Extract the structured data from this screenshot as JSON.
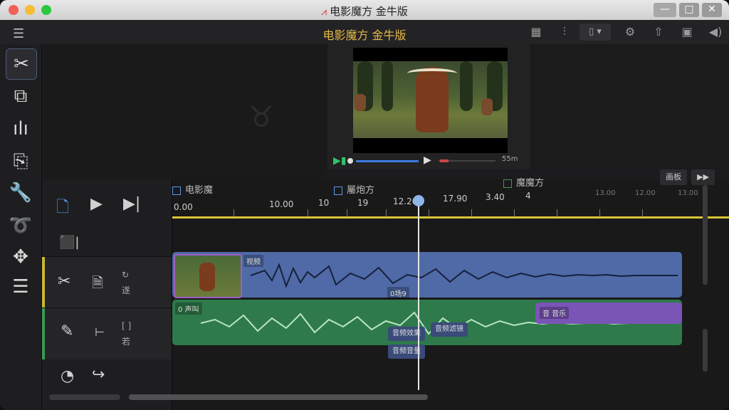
{
  "window": {
    "title": "电影魔方 金牛版",
    "controls": [
      "—",
      "□",
      "✕"
    ]
  },
  "toolbar": {
    "menu_icon": "☰",
    "app_title": "电影魔方 金牛版",
    "icons": [
      "grid-icon",
      "split-icon",
      "device-dropdown",
      "gear-icon",
      "upload-icon",
      "image-icon",
      "volume-icon"
    ]
  },
  "left_tools": [
    "scissors-icon",
    "crop-icon",
    "audio-wave-icon",
    "file-icon",
    "wrench-icon",
    "lasso-icon",
    "move-icon",
    "layers-icon"
  ],
  "preview": {
    "time_label": "55m"
  },
  "timeline": {
    "track_labels": [
      "电影魔",
      "屬炮方",
      "魔魔方"
    ],
    "ruler_labels": [
      "0.00",
      "10.00",
      "10",
      "19",
      "12.20",
      "17.90",
      "3.40",
      "4",
      "13.00",
      "12.00",
      "13.00"
    ],
    "top_buttons": [
      "画板",
      "▶▶"
    ],
    "left_small": {
      "row1_text": "遂",
      "row2_text": "若"
    },
    "clips": {
      "video_label": "视频",
      "audio_label1": "0 声叫",
      "audio_label2": "0场9",
      "purple_label": "音 音乐",
      "small1": "音频效果",
      "small2": "音频滤镜",
      "small3": "音频音量"
    }
  }
}
